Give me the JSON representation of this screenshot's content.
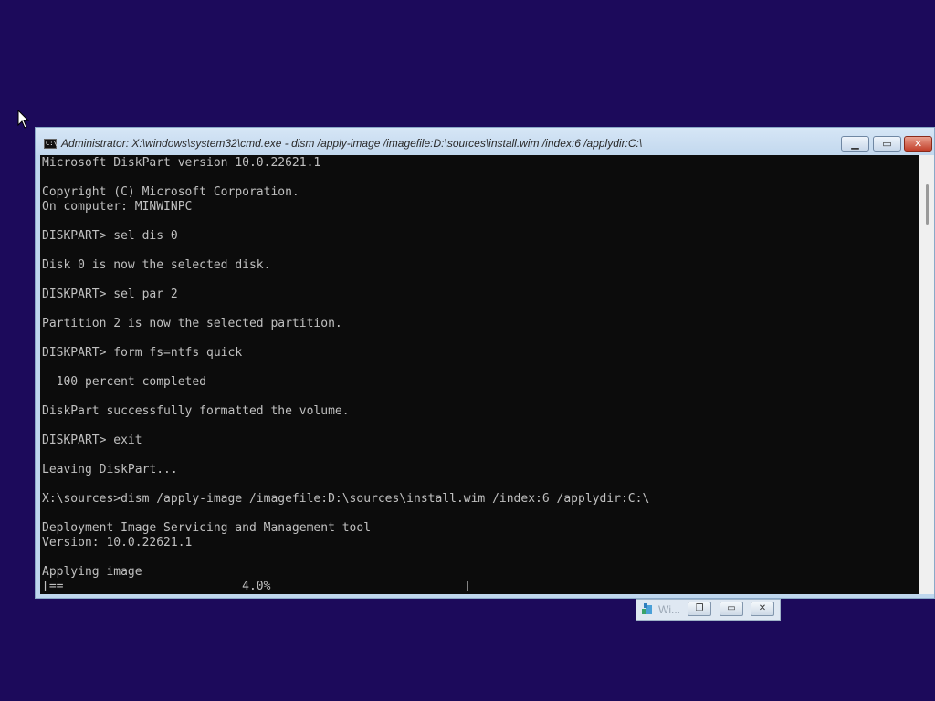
{
  "desktop": {
    "background": "#1c0a5b"
  },
  "cmd_window": {
    "title": "Administrator: X:\\windows\\system32\\cmd.exe - dism  /apply-image /imagefile:D:\\sources\\install.wim /index:6 /applydir:C:\\",
    "icon": "C:\\",
    "buttons": {
      "minimize": "minimize-icon",
      "maximize": "maximize-icon",
      "close": "close-icon"
    },
    "console_lines": [
      "Microsoft DiskPart version 10.0.22621.1",
      "",
      "Copyright (C) Microsoft Corporation.",
      "On computer: MINWINPC",
      "",
      "DISKPART> sel dis 0",
      "",
      "Disk 0 is now the selected disk.",
      "",
      "DISKPART> sel par 2",
      "",
      "Partition 2 is now the selected partition.",
      "",
      "DISKPART> form fs=ntfs quick",
      "",
      "  100 percent completed",
      "",
      "DiskPart successfully formatted the volume.",
      "",
      "DISKPART> exit",
      "",
      "Leaving DiskPart...",
      "",
      "X:\\sources>dism /apply-image /imagefile:D:\\sources\\install.wim /index:6 /applydir:C:\\",
      "",
      "Deployment Image Servicing and Management tool",
      "Version: 10.0.22621.1",
      "",
      "Applying image",
      "[==                         4.0%                           ]"
    ]
  },
  "minimized_window": {
    "title": "Wi..."
  }
}
